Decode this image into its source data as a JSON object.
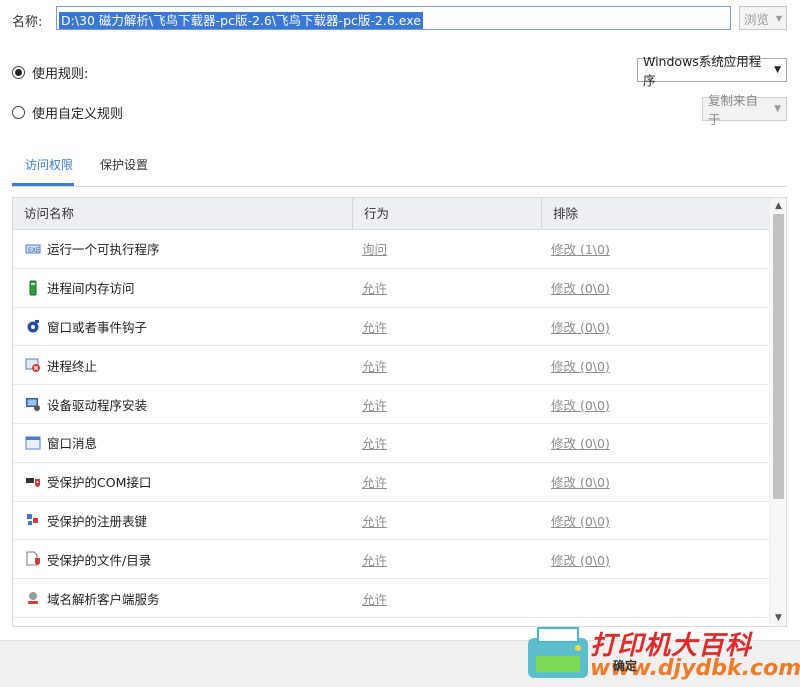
{
  "name_label": "名称:",
  "name_value": "D:\\30 磁力解析\\飞鸟下载器-pc版-2.6\\飞鸟下载器-pc版-2.6.exe",
  "browse_label": "浏览",
  "use_rule_label": "使用规则:",
  "rule_select_value": "Windows系统应用程序",
  "use_custom_label": "使用自定义规则",
  "copy_from_value": "复制来自于",
  "tabs": [
    {
      "label": "访问权限"
    },
    {
      "label": "保护设置"
    }
  ],
  "columns": [
    "访问名称",
    "行为",
    "排除"
  ],
  "rows": [
    {
      "icon": "run-program-icon",
      "name": "运行一个可执行程序",
      "action": "询问",
      "exclude": "修改 (1\\0)"
    },
    {
      "icon": "memory-access-icon",
      "name": "进程间内存访问",
      "action": "允许",
      "exclude": "修改 (0\\0)"
    },
    {
      "icon": "hook-icon",
      "name": "窗口或者事件钩子",
      "action": "允许",
      "exclude": "修改 (0\\0)"
    },
    {
      "icon": "process-terminate-icon",
      "name": "进程终止",
      "action": "允许",
      "exclude": "修改 (0\\0)"
    },
    {
      "icon": "driver-install-icon",
      "name": "设备驱动程序安装",
      "action": "允许",
      "exclude": "修改 (0\\0)"
    },
    {
      "icon": "window-message-icon",
      "name": "窗口消息",
      "action": "允许",
      "exclude": "修改 (0\\0)"
    },
    {
      "icon": "com-interface-icon",
      "name": "受保护的COM接口",
      "action": "允许",
      "exclude": "修改 (0\\0)"
    },
    {
      "icon": "registry-key-icon",
      "name": "受保护的注册表键",
      "action": "允许",
      "exclude": "修改 (0\\0)"
    },
    {
      "icon": "file-folder-icon",
      "name": "受保护的文件/目录",
      "action": "允许",
      "exclude": "修改 (0\\0)"
    },
    {
      "icon": "dns-client-icon",
      "name": "域名解析客户端服务",
      "action": "允许",
      "exclude": ""
    }
  ],
  "footer": {
    "ok_label": "确定"
  },
  "watermark": {
    "line1": "打印机大百科",
    "line2": "www.djydbk.com"
  },
  "colors": {
    "accent": "#3a7bd5",
    "selection": "#3a78d8",
    "link_gray": "#8c8c8c"
  }
}
